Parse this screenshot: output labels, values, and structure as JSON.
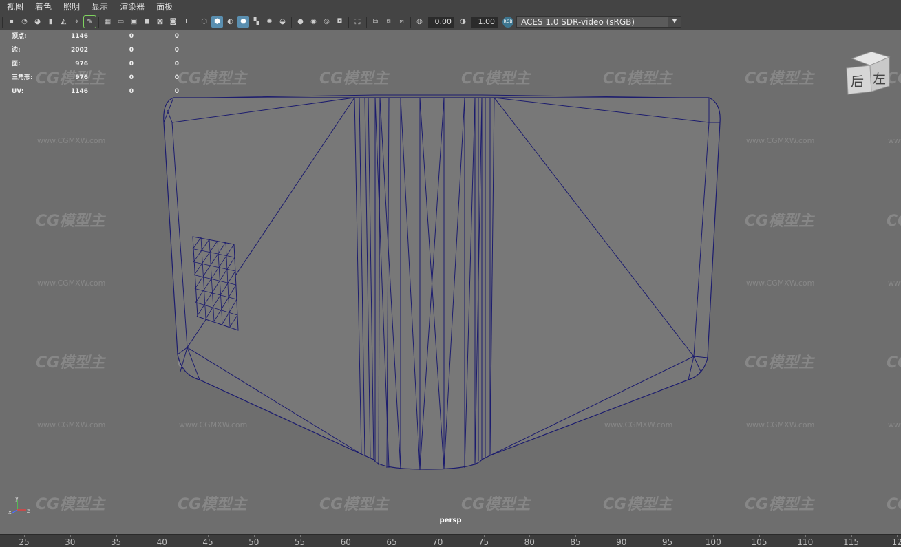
{
  "menu": [
    "视图",
    "着色",
    "照明",
    "显示",
    "渲染器",
    "面板"
  ],
  "toolbar": {
    "icons": [
      {
        "name": "select-camera-icon",
        "glyph": "▪"
      },
      {
        "name": "camera-attributes-icon",
        "glyph": "◔"
      },
      {
        "name": "bookmarks-icon",
        "glyph": "◕"
      },
      {
        "name": "bookmark-icon",
        "glyph": "▮"
      },
      {
        "name": "image-plane-icon",
        "glyph": "◭"
      },
      {
        "name": "2d-pan-zoom-icon",
        "glyph": "⌖"
      },
      {
        "name": "grease-pencil-icon",
        "glyph": "✎",
        "highlight": true
      },
      {
        "sep": true
      },
      {
        "name": "grid-icon",
        "glyph": "▦"
      },
      {
        "name": "film-gate-icon",
        "glyph": "▭"
      },
      {
        "name": "resolution-gate-icon",
        "glyph": "▣"
      },
      {
        "name": "gate-mask-icon",
        "glyph": "◼"
      },
      {
        "name": "field-chart-icon",
        "glyph": "▩"
      },
      {
        "name": "safe-action-icon",
        "glyph": "◙"
      },
      {
        "name": "safe-title-icon",
        "glyph": "T"
      },
      {
        "sep": true
      },
      {
        "name": "wireframe-icon",
        "glyph": "⬡"
      },
      {
        "name": "smooth-shade-icon",
        "glyph": "⬢",
        "active": true
      },
      {
        "name": "default-material-icon",
        "glyph": "◐"
      },
      {
        "name": "wireframe-on-shaded-icon",
        "glyph": "⬣",
        "active": true
      },
      {
        "name": "textured-icon",
        "glyph": "▚"
      },
      {
        "name": "use-all-lights-icon",
        "glyph": "✺"
      },
      {
        "name": "shadows-icon",
        "glyph": "◒"
      },
      {
        "sep": true
      },
      {
        "name": "screen-space-ao-icon",
        "glyph": "●"
      },
      {
        "name": "motion-blur-icon",
        "glyph": "◉"
      },
      {
        "name": "anti-aliasing-icon",
        "glyph": "◎"
      },
      {
        "name": "depth-of-field-icon",
        "glyph": "◘"
      },
      {
        "sep": true
      },
      {
        "name": "isolate-select-icon",
        "glyph": "⬚"
      },
      {
        "sep": true
      },
      {
        "name": "xray-icon",
        "glyph": "⧉"
      },
      {
        "name": "xray-active-components-icon",
        "glyph": "⧈"
      },
      {
        "name": "xray-joints-icon",
        "glyph": "⧄"
      },
      {
        "sep": true
      },
      {
        "name": "exposure-icon",
        "glyph": "◍"
      }
    ],
    "exposure_value": "0.00",
    "gamma_icon": "gamma-icon",
    "gamma_value": "1.00",
    "color_space_badge": "RGB",
    "color_space_value": "ACES 1.0 SDR-video (sRGB)"
  },
  "hud_stats": [
    {
      "label": "顶点:",
      "values": [
        "1146",
        "0",
        "0"
      ]
    },
    {
      "label": "边:",
      "values": [
        "2002",
        "0",
        "0"
      ]
    },
    {
      "label": "面:",
      "values": [
        "976",
        "0",
        "0"
      ]
    },
    {
      "label": "三角形:",
      "values": [
        "976",
        "0",
        "0"
      ]
    },
    {
      "label": "UV:",
      "values": [
        "1146",
        "0",
        "0"
      ]
    }
  ],
  "viewcube": {
    "front_label": "后",
    "side_label": "左"
  },
  "camera_label": "persp",
  "axis_labels": {
    "y": "y",
    "x": "x",
    "z": "z"
  },
  "watermark": {
    "logo": "CG模型主",
    "url": "www.CGMXW.com"
  },
  "timeline_ticks": [
    "25",
    "30",
    "35",
    "40",
    "45",
    "50",
    "55",
    "60",
    "65",
    "70",
    "75",
    "80",
    "85",
    "90",
    "95",
    "100",
    "105",
    "110",
    "115",
    "12"
  ],
  "colors": {
    "wire": "#1c1c6e",
    "mesh_fill": "#777777",
    "viewport_bg": "#6e6e6e",
    "active_button": "#5a8fb0"
  }
}
